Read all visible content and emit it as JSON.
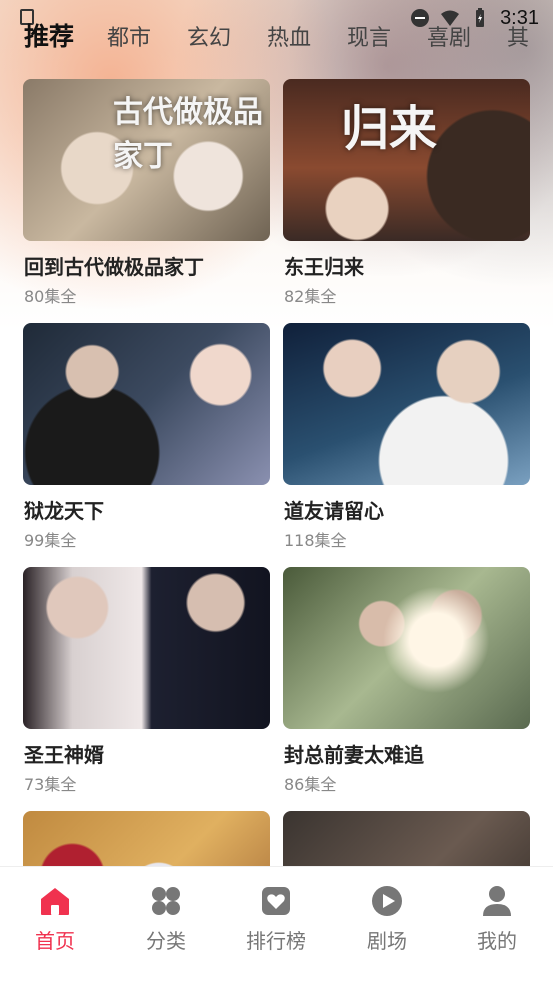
{
  "status_bar": {
    "time": "3:31"
  },
  "tabs": [
    {
      "label": "推荐",
      "active": true
    },
    {
      "label": "都市"
    },
    {
      "label": "玄幻"
    },
    {
      "label": "热血"
    },
    {
      "label": "现言"
    },
    {
      "label": "喜剧"
    },
    {
      "label": "其"
    }
  ],
  "dramas": [
    {
      "title": "回到古代做极品家丁",
      "episodes": "80集全",
      "poster_text": "古代做极品家丁"
    },
    {
      "title": "东王归来",
      "episodes": "82集全",
      "poster_text": "归来"
    },
    {
      "title": "狱龙天下",
      "episodes": "99集全"
    },
    {
      "title": "道友请留心",
      "episodes": "118集全"
    },
    {
      "title": "圣王神婿",
      "episodes": "73集全"
    },
    {
      "title": "封总前妻太难追",
      "episodes": "86集全"
    }
  ],
  "bottom_nav": [
    {
      "label": "首页",
      "icon": "home-icon",
      "active": true
    },
    {
      "label": "分类",
      "icon": "category-icon"
    },
    {
      "label": "排行榜",
      "icon": "ranking-icon"
    },
    {
      "label": "剧场",
      "icon": "play-icon"
    },
    {
      "label": "我的",
      "icon": "profile-icon"
    }
  ],
  "colors": {
    "accent": "#f0324f",
    "text": "#222222",
    "muted": "#888888"
  }
}
